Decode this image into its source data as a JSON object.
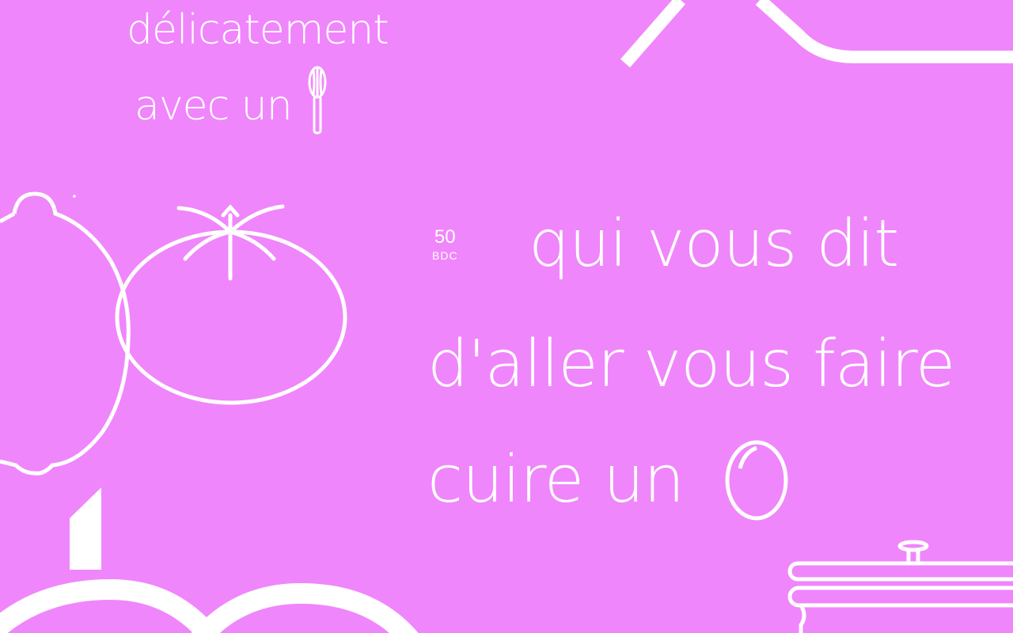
{
  "colors": {
    "background": "#f086fb",
    "ink": "#ffffff"
  },
  "icons": {
    "whisk": "whisk-icon",
    "lemon": "lemon-icon",
    "tomato": "tomato-icon",
    "egg": "egg-icon",
    "pot": "cooking-pot-icon"
  },
  "top_text": {
    "line1": "délicatement",
    "line2": "avec un"
  },
  "badge": {
    "number": "50",
    "label": "BDC"
  },
  "main_text": {
    "line1": "qui vous dit",
    "line2": "d'aller vous faire",
    "line3": "cuire un"
  }
}
